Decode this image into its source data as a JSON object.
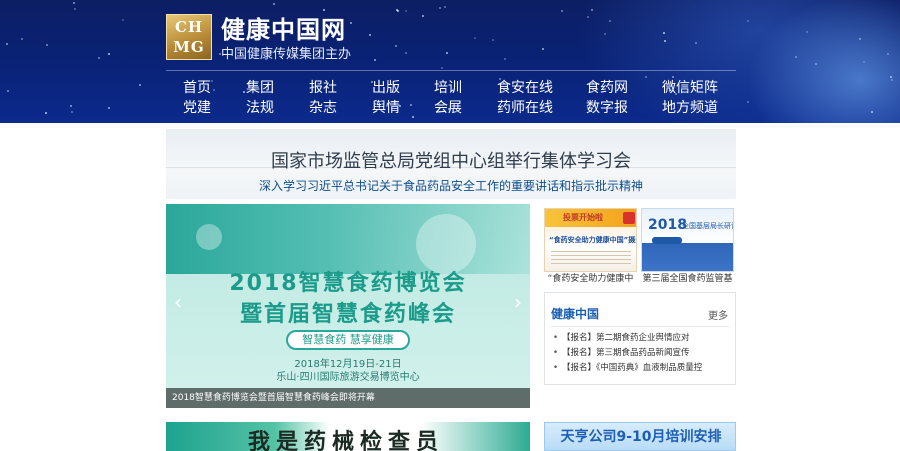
{
  "header": {
    "logo_text_line1": "CH",
    "logo_text_line2": "MG",
    "site_name": "健康中国网",
    "site_subtitle": "中国健康传媒集团主办",
    "nav": [
      [
        "首页",
        "党建"
      ],
      [
        "集团",
        "法规"
      ],
      [
        "报社",
        "杂志"
      ],
      [
        "出版",
        "舆情"
      ],
      [
        "培训",
        "会展"
      ],
      [
        "食安在线",
        "药师在线"
      ],
      [
        "食药网",
        "数字报"
      ],
      [
        "微信矩阵",
        "地方频道"
      ]
    ]
  },
  "banner": {
    "title": "国家市场监管总局党组中心组举行集体学习会",
    "subtitle": "深入学习习近平总书记关于食品药品安全工作的重要讲话和指示批示精神"
  },
  "slider": {
    "line1": "2018智慧食药博览会",
    "line2": "暨首届智慧食药峰会",
    "pill": "智慧食药 慧享健康",
    "date": "2018年12月19日-21日",
    "venue": "乐山·四川国际旅游交易博览中心",
    "caption": "2018智慧食药博览会暨首届智慧食药峰会即将开幕",
    "prev_icon": "chevron-left-icon",
    "next_icon": "chevron-right-icon"
  },
  "thumbs": [
    {
      "top_text": "投票开始啦",
      "mid_text": "“食药安全助力健康中国”摄影大赛",
      "caption": "“食药安全助力健康中"
    },
    {
      "big_text": "2018",
      "small_text": "全国基层局长研讨会",
      "caption": "第三届全国食药监管基"
    }
  ],
  "news": {
    "title": "健康中国",
    "more": "更多",
    "items": [
      "【报名】第二期食药企业舆情应对",
      "【报名】第三期食品药品新闻宣传",
      "【报名】《中国药典》血液制品质量控"
    ]
  },
  "bottom": {
    "left_text": "我是药械检查员",
    "right_text": "天亨公司9-10月培训安排"
  },
  "colors": {
    "header_bg": "#0a2378",
    "accent_blue": "#1a5fb4",
    "teal": "#1b9b8a"
  }
}
